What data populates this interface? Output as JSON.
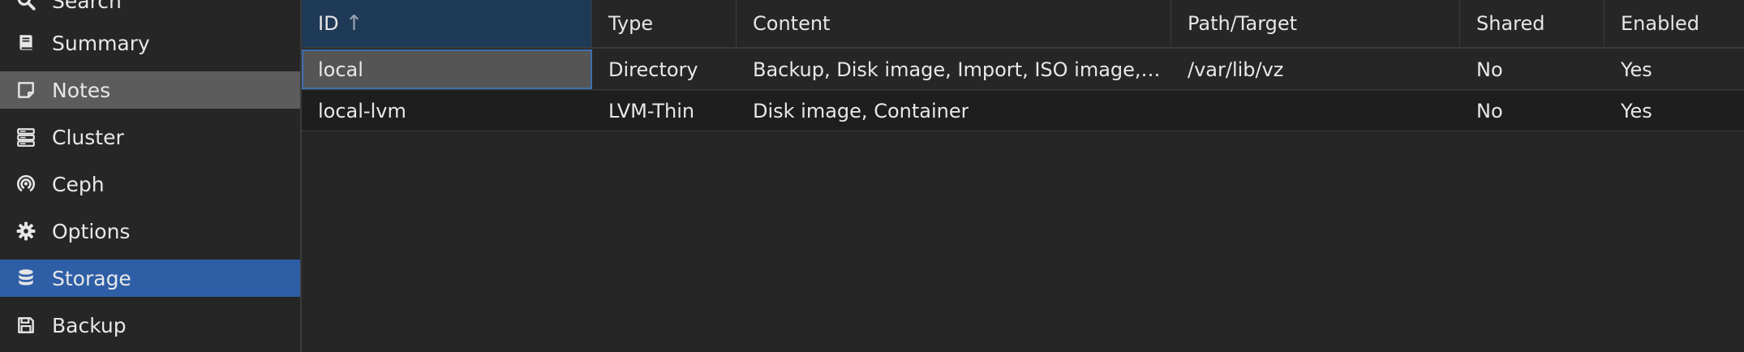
{
  "sidebar": {
    "items": [
      {
        "label": "Search",
        "icon": "search-icon"
      },
      {
        "label": "Summary",
        "icon": "book-icon"
      },
      {
        "label": "Notes",
        "icon": "sticky-note-icon",
        "state": "hover"
      },
      {
        "label": "Cluster",
        "icon": "server-icon"
      },
      {
        "label": "Ceph",
        "icon": "ceph-icon"
      },
      {
        "label": "Options",
        "icon": "gear-icon"
      },
      {
        "label": "Storage",
        "icon": "database-icon",
        "state": "selected"
      },
      {
        "label": "Backup",
        "icon": "floppy-disk-icon"
      }
    ]
  },
  "grid": {
    "columns": [
      "ID",
      "Type",
      "Content",
      "Path/Target",
      "Shared",
      "Enabled"
    ],
    "sort_indicator": "↑",
    "rows": [
      {
        "id": "local",
        "type": "Directory",
        "content": "Backup, Disk image, Import, ISO image,…",
        "path": "/var/lib/vz",
        "shared": "No",
        "enabled": "Yes"
      },
      {
        "id": "local-lvm",
        "type": "LVM-Thin",
        "content": "Disk image, Container",
        "path": "",
        "shared": "No",
        "enabled": "Yes"
      }
    ]
  },
  "colors": {
    "selected": "#2e5ea6",
    "hover": "#5c5c5c",
    "sorted_header": "#1f3a56",
    "background": "#262626"
  }
}
